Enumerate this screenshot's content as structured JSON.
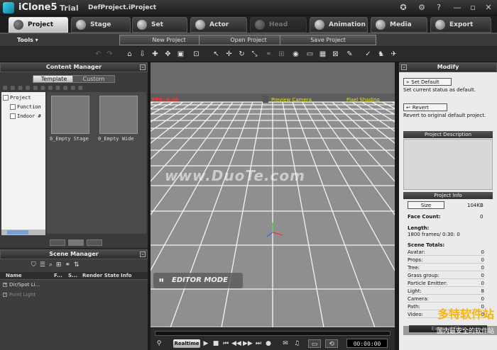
{
  "titlebar": {
    "app_name": "iClone5",
    "edition": "Trial",
    "project_file": "DefProject.iProject"
  },
  "main_tabs": [
    {
      "label": "Project",
      "icon": "project-icon",
      "state": "active"
    },
    {
      "label": "Stage",
      "icon": "stage-icon",
      "state": "normal"
    },
    {
      "label": "Set",
      "icon": "set-icon",
      "state": "normal"
    },
    {
      "label": "Actor",
      "icon": "actor-icon",
      "state": "normal"
    },
    {
      "label": "Head",
      "icon": "head-icon",
      "state": "disabled"
    },
    {
      "label": "Animation",
      "icon": "animation-icon",
      "state": "normal"
    },
    {
      "label": "Media",
      "icon": "media-icon",
      "state": "normal"
    },
    {
      "label": "Export",
      "icon": "export-icon",
      "state": "normal"
    }
  ],
  "subbar": {
    "tools_menu": "Tools ▾",
    "new_project": "New Project",
    "open_project": "Open Project",
    "save_project": "Save Project"
  },
  "content_manager": {
    "title": "Content Manager",
    "tabs": [
      "Template",
      "Custom"
    ],
    "tree": [
      "Project",
      "Function",
      "Indoor #"
    ],
    "thumbnails": [
      "0_Empty Stage",
      "0_Empty Wide"
    ]
  },
  "scene_manager": {
    "title": "Scene Manager",
    "columns": [
      "Name",
      "F...",
      "S...",
      "Render State",
      "Info"
    ],
    "rows": [
      "Dir/Spot Li...",
      "Point Light"
    ]
  },
  "viewport": {
    "fps": "FPS: 0.00",
    "camera": "Preview Camera",
    "shading": "Pixel Shading",
    "mode": "EDITOR MODE",
    "watermark": "www.DuoTe.com"
  },
  "timeline": {
    "realtime": "Realtime",
    "timecode": "00:00:00"
  },
  "modify": {
    "title": "Modify",
    "set_default": "Set Default",
    "set_default_desc": "Set current status as default.",
    "revert": "Revert",
    "revert_desc": "Revert to original default project.",
    "project_description": "Project Description",
    "project_info": "Project Info",
    "size_label": "Size",
    "size_value": "104KB",
    "face_count_label": "Face Count:",
    "face_count_value": "0",
    "length_label": "Length:",
    "length_value": "1800 frames/ 0:30: 0",
    "scene_totals_label": "Scene Totals:",
    "totals": [
      {
        "label": "Avatar:",
        "value": "0"
      },
      {
        "label": "Props:",
        "value": "0"
      },
      {
        "label": "Tree:",
        "value": "0"
      },
      {
        "label": "Grass group:",
        "value": "0"
      },
      {
        "label": "Particle Emitter:",
        "value": "0"
      },
      {
        "label": "Light:",
        "value": "8"
      },
      {
        "label": "Camera:",
        "value": "0"
      },
      {
        "label": "Path:",
        "value": "0"
      },
      {
        "label": "Video:",
        "value": "0"
      }
    ],
    "external_files": "External Files"
  },
  "corner_watermark": {
    "line1": "多特软件站",
    "line2": "国内最安全的软件站"
  }
}
